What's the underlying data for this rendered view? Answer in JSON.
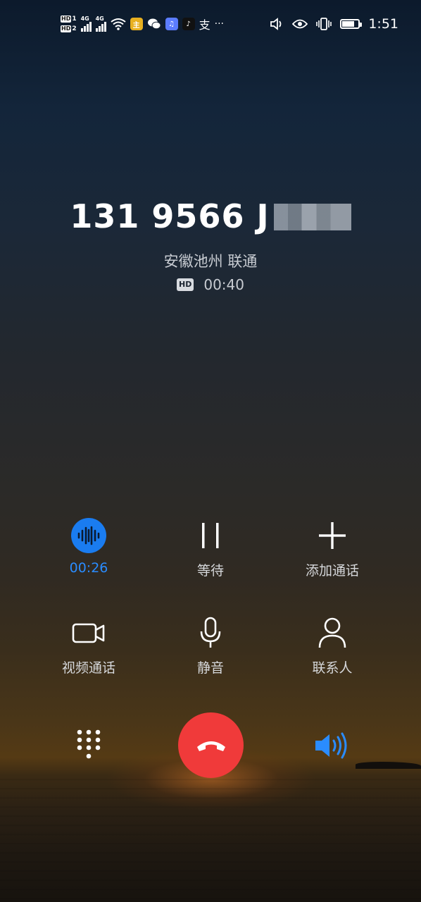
{
  "status_bar": {
    "hd1": "HD",
    "hd2": "HD",
    "sim1": "1",
    "sim2": "2",
    "network1": "4G",
    "network2": "4G",
    "app_notice_text": "主",
    "alipay_text": "支",
    "more": "···",
    "time": "1:51",
    "battery_level": 0.75
  },
  "call": {
    "number_visible": "131 9566 J",
    "location": "安徽池州 联通",
    "hd_label": "HD",
    "duration": "00:40"
  },
  "controls": {
    "record": {
      "label": "00:26",
      "active": true
    },
    "hold": {
      "label": "等待"
    },
    "add_call": {
      "label": "添加通话"
    },
    "video_call": {
      "label": "视频通话"
    },
    "mute": {
      "label": "静音"
    },
    "contacts": {
      "label": "联系人"
    }
  },
  "bottom_bar": {
    "dialpad": "dialpad-icon",
    "end_call": "end-call-icon",
    "speaker": "speaker-icon"
  },
  "colors": {
    "accent": "#2a8cff",
    "end_call": "#f03a3a"
  }
}
